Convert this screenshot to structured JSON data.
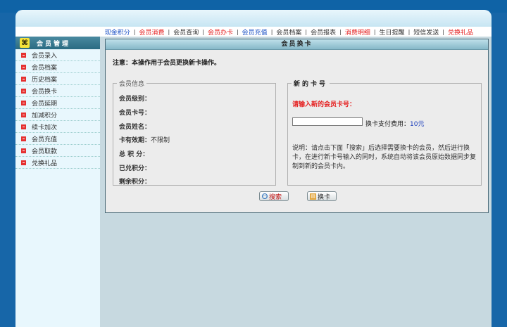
{
  "nav": {
    "items": [
      {
        "label": "现金积分",
        "color": "#1a4fc4"
      },
      {
        "label": "会员消费",
        "color": "#e52020"
      },
      {
        "label": "会员查询",
        "color": "#333333"
      },
      {
        "label": "会员办卡",
        "color": "#e52020"
      },
      {
        "label": "会员充值",
        "color": "#1a4fc4"
      },
      {
        "label": "会员档案",
        "color": "#333333"
      },
      {
        "label": "会员报表",
        "color": "#333333"
      },
      {
        "label": "消费明细",
        "color": "#e52020"
      },
      {
        "label": "生日提醒",
        "color": "#333333"
      },
      {
        "label": "短信发送",
        "color": "#333333"
      },
      {
        "label": "兑换礼品",
        "color": "#e52020"
      }
    ],
    "separator": "|"
  },
  "sidebar": {
    "title": "会员管理",
    "items": [
      {
        "label": "会员录入"
      },
      {
        "label": "会员档案"
      },
      {
        "label": "历史档案"
      },
      {
        "label": "会员换卡"
      },
      {
        "label": "会员延期"
      },
      {
        "label": "加减积分"
      },
      {
        "label": "续卡加次"
      },
      {
        "label": "会员充值"
      },
      {
        "label": "会员取款"
      },
      {
        "label": "兑换礼品"
      }
    ]
  },
  "panel": {
    "title": "会员换卡",
    "notice": "注意：本操作用于会员更换新卡操作。"
  },
  "member_info": {
    "legend": "会员信息",
    "level_label": "会员级别：",
    "card_no_label": "会员卡号：",
    "name_label": "会员姓名：",
    "validity_label": "卡有效期：",
    "validity_value": "不限制",
    "total_points_label": "总 积 分：",
    "redeemed_points_label": "已兑积分：",
    "remaining_points_label": "剩余积分："
  },
  "new_card": {
    "legend": "新的卡号",
    "prompt": "请输入新的会员卡号：",
    "input_value": "",
    "fee_label": "换卡支付费用：",
    "fee_value": "10元",
    "description": "说明：请点击下面「搜索」后选择需要换卡的会员，然后进行换卡，在进行新卡号输入的同时，系统自动将该会员原始数据同步复制到新的会员卡内。"
  },
  "buttons": {
    "search_label": "搜索",
    "exchange_label": "换卡"
  }
}
